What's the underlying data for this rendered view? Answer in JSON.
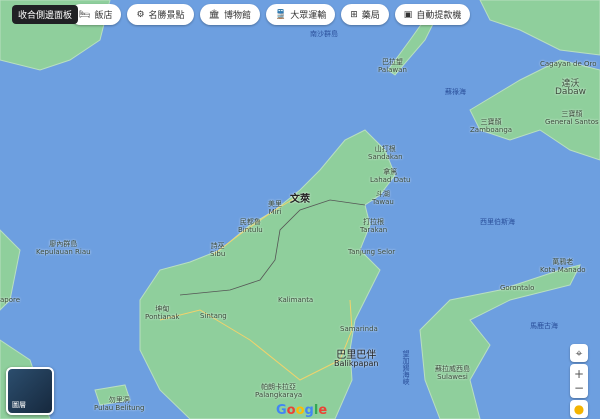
{
  "toolbar": {
    "collapse_label": "收合側邊面板",
    "chips": [
      {
        "label": "飯店",
        "icon": "bed-icon"
      },
      {
        "label": "名勝景點",
        "icon": "camera-icon"
      },
      {
        "label": "博物館",
        "icon": "museum-icon"
      },
      {
        "label": "大眾運輸",
        "icon": "train-icon"
      },
      {
        "label": "藥局",
        "icon": "pharmacy-icon"
      },
      {
        "label": "自動提款機",
        "icon": "atm-icon"
      }
    ]
  },
  "labels": {
    "brunei": "文萊",
    "miri_zh": "美里",
    "miri": "Miri",
    "bintulu_zh": "民都魯",
    "bintulu": "Bintulu",
    "sibu_zh": "詩巫",
    "sibu": "Sibu",
    "sandakan_zh": "山打根",
    "sandakan": "Sandakan",
    "lahad_zh": "拿篤",
    "lahad": "Lahad Datu",
    "tawau_zh": "斗湖",
    "tawau": "Tawau",
    "tarakan_zh": "打拉根",
    "tarakan": "Tarakan",
    "tanjung": "Tanjung Selor",
    "kalimantan": "Kalimanta",
    "samarinda": "Samarinda",
    "balikpapan_zh": "巴里巴伴",
    "balikpapan": "Balikpapan",
    "palangka_zh": "帕朗卡拉亞",
    "palangka": "Palangkaraya",
    "pontianak_zh": "坤甸",
    "pontianak": "Pontianak",
    "sintang": "Sintang",
    "riau_zh": "廖內群島",
    "riau": "Kepulauan Riau",
    "belitung_zh": "勿里洞",
    "belitung": "Pulau Belitung",
    "sulu": "蘇祿海",
    "celebes": "西里伯斯海",
    "makassar": "望加錫海峽",
    "molucca": "馬鹿古海",
    "palawan_zh": "巴拉望",
    "palawan": "Palawan",
    "zamboanga_zh": "三寶顏",
    "zamboanga": "Zamboanga",
    "davao_zh": "達沃",
    "davao": "Dabaw",
    "gensan_zh": "三寶顏",
    "gensan": "General Santos",
    "cagayan": "Cagayan de Oro",
    "manado_zh": "萬鴉老",
    "manado": "Kota Manado",
    "gorontalo": "Gorontalo",
    "sulawesi_zh": "蘇拉威西島",
    "sulawesi": "Sulawesi",
    "singapore": "apore",
    "south_china_sea": "南沙群島"
  },
  "controls": {
    "layer_label": "圖層",
    "zoom_in": "+",
    "zoom_out": "−",
    "logo": "Google"
  },
  "colors": {
    "water": "#6d9fe0",
    "land": "#8fcf9c",
    "road": "#f2d26b",
    "border": "#555555"
  }
}
